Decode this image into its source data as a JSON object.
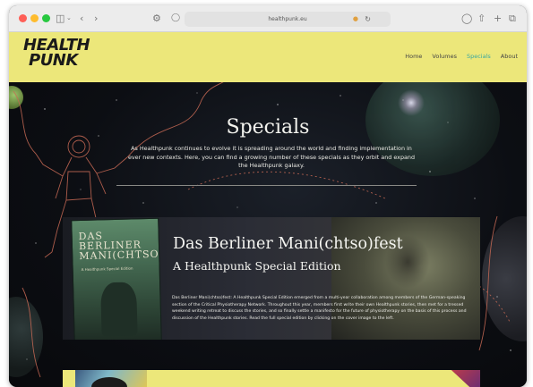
{
  "browser": {
    "url": "healthpunk.eu",
    "icons": {
      "sidebar": "sidebar-icon",
      "back": "chevron-left-icon",
      "forward": "chevron-right-icon",
      "shield": "shield-icon",
      "audio": "speaker-icon",
      "reload": "reload-icon",
      "downloads": "download-icon",
      "share": "share-icon",
      "new_tab": "plus-icon",
      "tabs": "tabs-icon"
    }
  },
  "site": {
    "logo_line1": "HEALTH",
    "logo_line2": "PUNK",
    "nav": [
      {
        "label": "Home"
      },
      {
        "label": "Volumes"
      },
      {
        "label": "Specials"
      },
      {
        "label": "About"
      }
    ],
    "accent_color": "#3aa8a0",
    "header_color": "#ece77a"
  },
  "page": {
    "title": "Specials",
    "intro": "As Healthpunk continues to evolve it is spreading around the world and finding implementation in ever new contexts. Here, you can find a growing number of these specials as they orbit and expand the Healthpunk galaxy."
  },
  "special": {
    "cover_title": "DAS BERLINER MANI(CHTSO)FEST",
    "cover_subtitle": "A Healthpunk Special Edition",
    "title": "Das Berliner Mani(chtso)fest",
    "subtitle": "A Healthpunk Special Edition",
    "description": "Das Berliner Mani(chtso)fest: A Healthpunk Special Edition emerged from a multi-year collaboration among members of the German-speaking section of the Critical Physiotherapy Network. Throughout this year, members first write their own Healthpunk stories, then met for a tressed weekend writing retreat to discuss the stories, and so finally settle a manifesto for the future of physiotherapy on the basis of this process and discussion of the Healthpunk stories. Read the full special edition by clicking on the cover image to the left."
  }
}
